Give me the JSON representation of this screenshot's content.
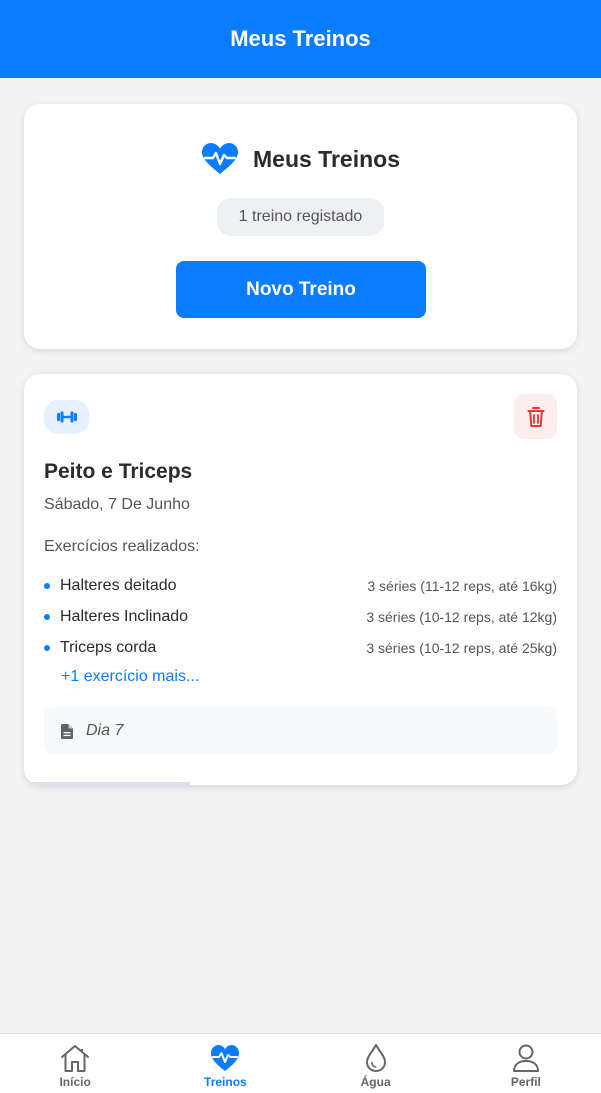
{
  "header": {
    "title": "Meus Treinos"
  },
  "summary": {
    "icon": "heart-pulse-icon",
    "title": "Meus Treinos",
    "count_text": "1 treino registado",
    "new_button_label": "Novo Treino"
  },
  "workout": {
    "type_icon": "dumbbell-icon",
    "delete_icon": "trash-icon",
    "title": "Peito e Triceps",
    "date": "Sábado, 7 De Junho",
    "exercises_label": "Exercícios realizados:",
    "exercises": [
      {
        "name": "Halteres deitado",
        "detail": "3 séries (11-12 reps, até 16kg)"
      },
      {
        "name": "Halteres Inclinado",
        "detail": "3 séries (10-12 reps, até 12kg)"
      },
      {
        "name": "Triceps corda",
        "detail": "3 séries (10-12 reps, até 25kg)"
      }
    ],
    "more_link": "+1 exercício mais...",
    "note_icon": "document-icon",
    "note": "Dia 7"
  },
  "nav": {
    "items": [
      {
        "label": "Início",
        "icon": "home-icon"
      },
      {
        "label": "Treinos",
        "icon": "heart-pulse-icon"
      },
      {
        "label": "Água",
        "icon": "water-drop-icon"
      },
      {
        "label": "Perfil",
        "icon": "user-icon"
      }
    ],
    "active": "Treinos"
  },
  "colors": {
    "accent": "#0a7cff",
    "danger": "#e53935",
    "background": "#f4f4f5"
  }
}
